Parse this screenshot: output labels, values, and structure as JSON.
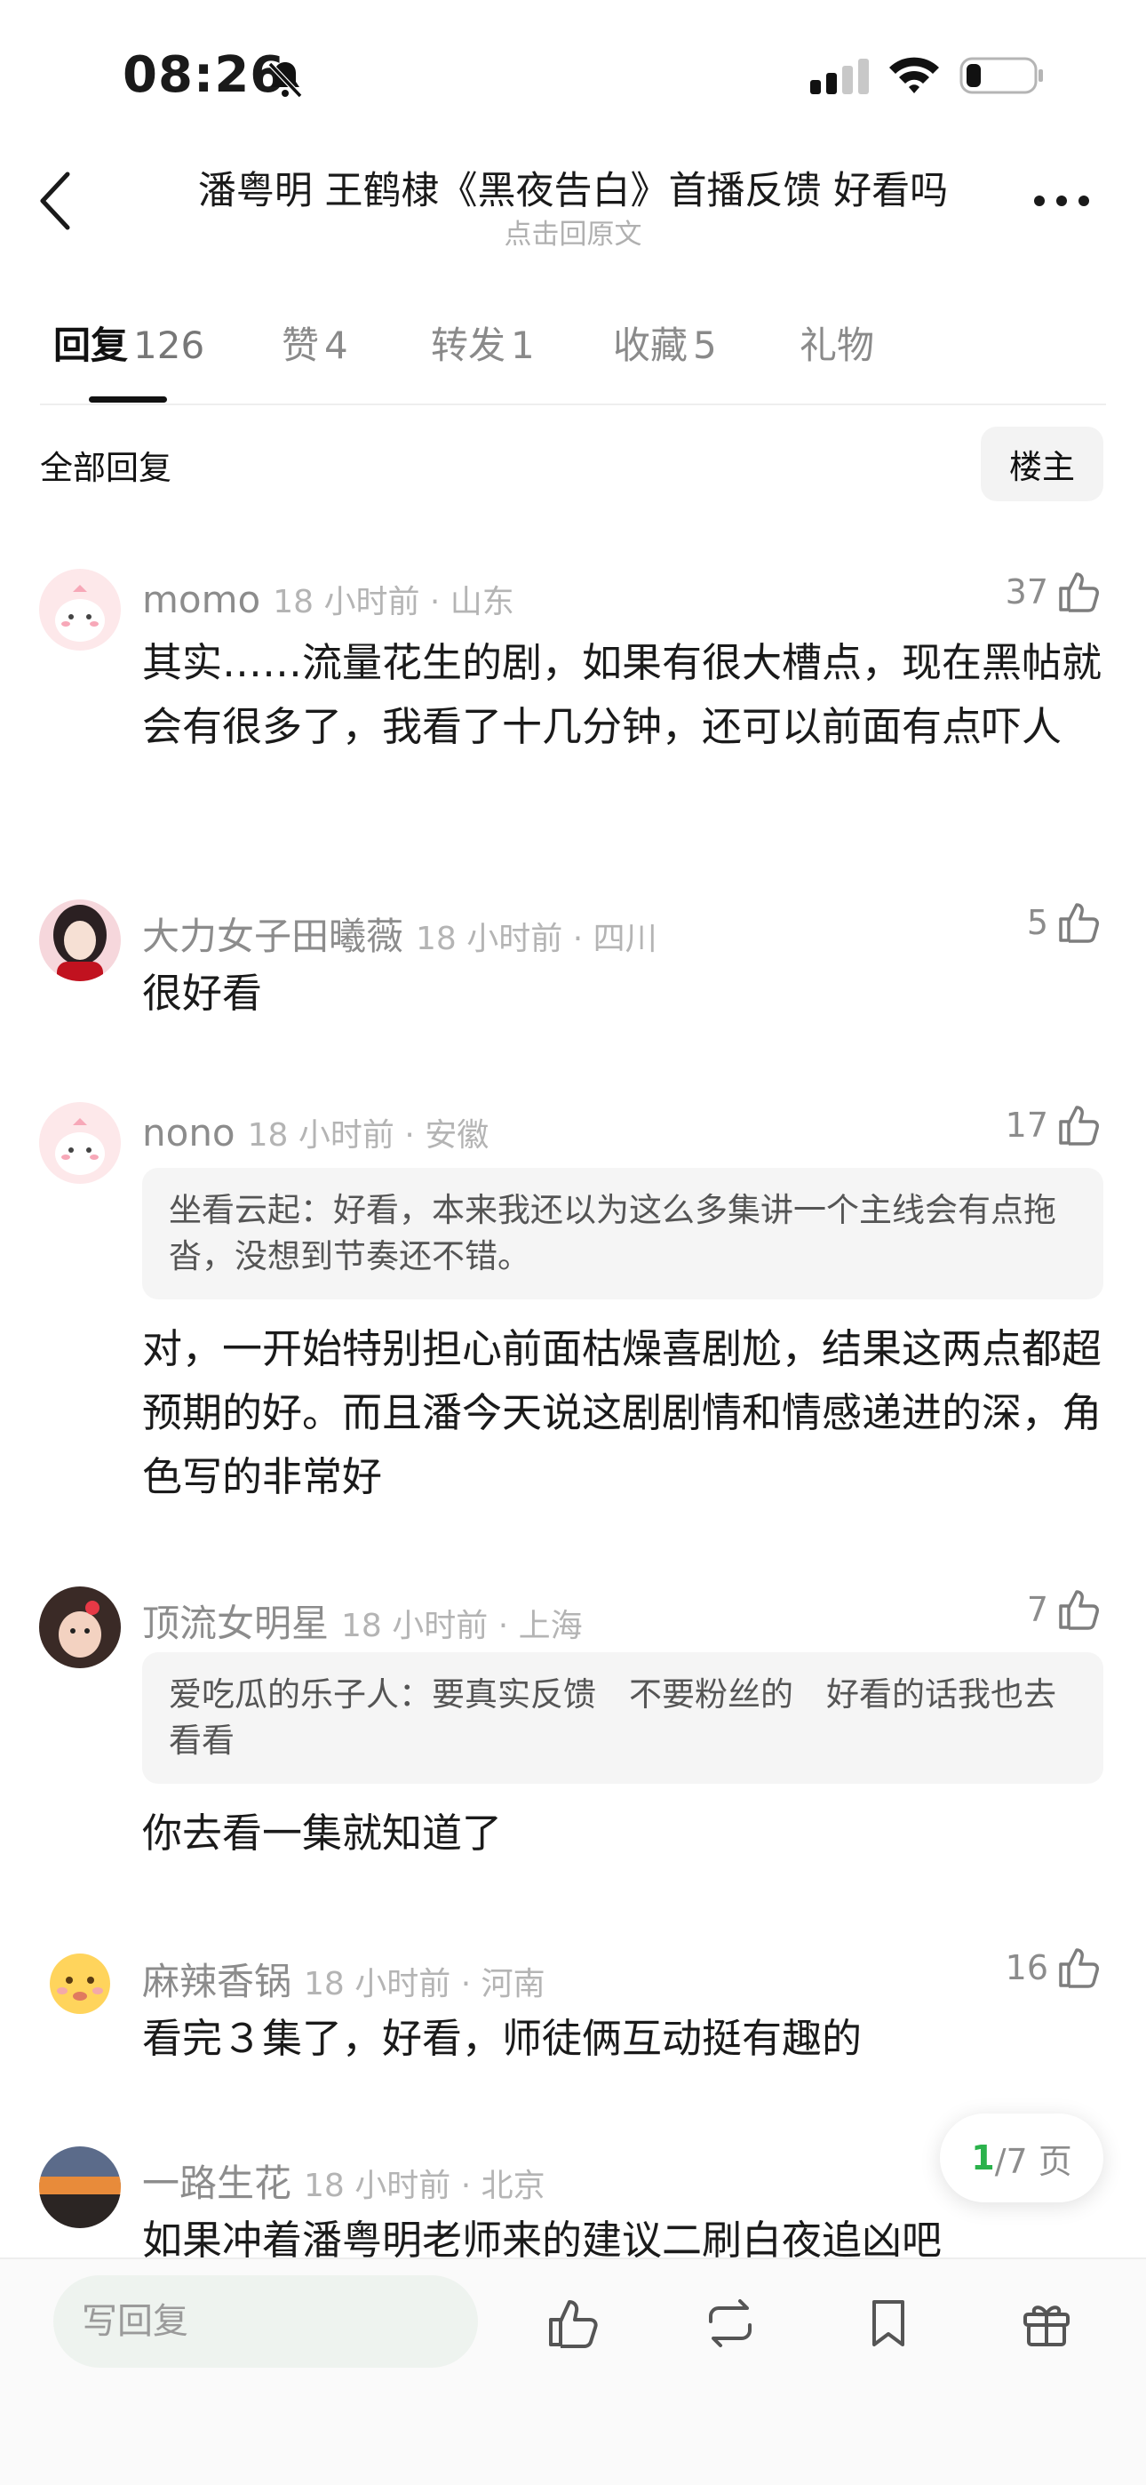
{
  "status_bar": {
    "time": "08:26"
  },
  "header": {
    "title": "潘粤明 王鹤棣《黑夜告白》首播反馈 好看吗",
    "subtitle": "点击回原文"
  },
  "tabs": [
    {
      "label": "回复",
      "count": "126"
    },
    {
      "label": "赞",
      "count": "4"
    },
    {
      "label": "转发",
      "count": "1"
    },
    {
      "label": "收藏",
      "count": "5"
    },
    {
      "label": "礼物",
      "count": ""
    }
  ],
  "filter": {
    "all_label": "全部回复",
    "owner_label": "楼主"
  },
  "comments": [
    {
      "user": "momo",
      "time": "18 小时前 · 山东",
      "likes": "37",
      "text": "其实……流量花生的剧，如果有很大槽点，现在黑帖就会有很多了，我看了十几分钟，还可以前面有点吓人"
    },
    {
      "user": "大力女子田曦薇",
      "time": "18 小时前 · 四川",
      "likes": "5",
      "text": "很好看"
    },
    {
      "user": "nono",
      "time": "18 小时前 · 安徽",
      "likes": "17",
      "quote_user": "坐看云起：",
      "quote_text": "好看，本来我还以为这么多集讲一个主线会有点拖沓，没想到节奏还不错。",
      "text": "对，一开始特别担心前面枯燥喜剧尬，结果这两点都超预期的好。而且潘今天说这剧剧情和情感递进的深，角色写的非常好"
    },
    {
      "user": "顶流女明星",
      "time": "18 小时前 · 上海",
      "likes": "7",
      "quote_user": "爱吃瓜的乐子人：",
      "quote_text": "要真实反馈　不要粉丝的　好看的话我也去看看",
      "text": "你去看一集就知道了"
    },
    {
      "user": "麻辣香锅",
      "time": "18 小时前 · 河南",
      "likes": "16",
      "text": "看完３集了，好看，师徒俩互动挺有趣的"
    },
    {
      "user": "一路生花",
      "time": "18 小时前 · 北京",
      "likes": "",
      "text": "如果冲着潘粤明老师来的建议二刷白夜追凶吧"
    }
  ],
  "pager": {
    "current": "1",
    "total": "/7 页"
  },
  "bottom_bar": {
    "reply_placeholder": "写回复"
  },
  "colors": {
    "accent": "#2bb24c",
    "text": "#1a1a1a",
    "muted": "#8c8c8c",
    "quote_bg": "#f5f5f5"
  }
}
